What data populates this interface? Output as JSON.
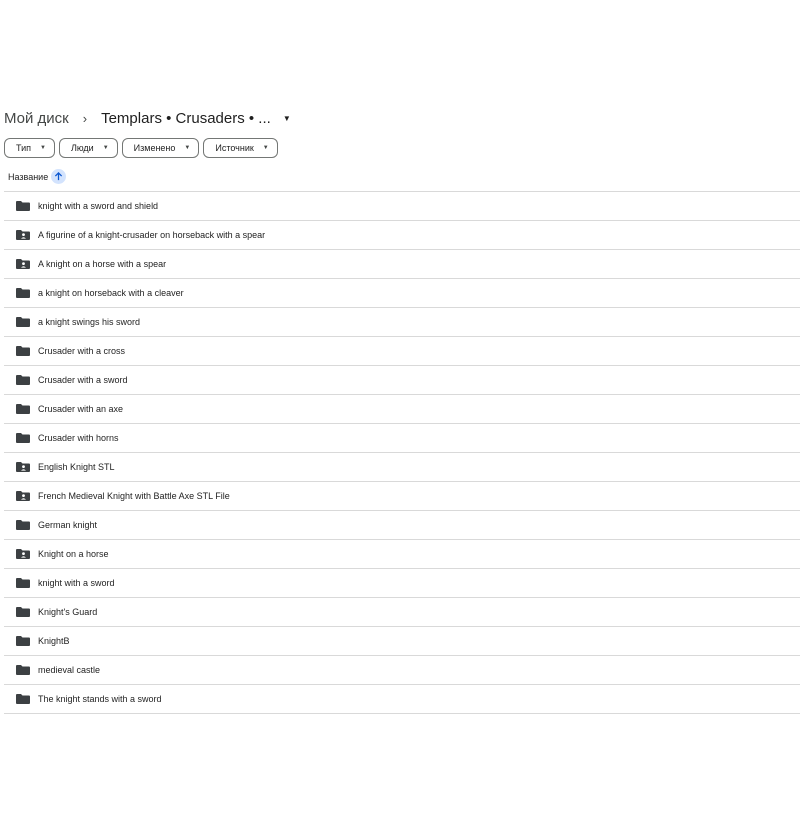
{
  "breadcrumb": {
    "root": "Мой диск",
    "separator": "›",
    "current": "Templars • Crusaders • ...",
    "caret_icon": "caret-down-icon"
  },
  "filters": [
    {
      "label": "Тип",
      "icon": "caret-down-icon"
    },
    {
      "label": "Люди",
      "icon": "caret-down-icon"
    },
    {
      "label": "Изменено",
      "icon": "caret-down-icon"
    },
    {
      "label": "Источник",
      "icon": "caret-down-icon"
    }
  ],
  "column_header": {
    "name_label": "Название",
    "sort_icon": "arrow-up-icon"
  },
  "files": [
    {
      "name": " knight with a sword and shield",
      "icon": "folder-icon"
    },
    {
      "name": "A figurine of a knight-crusader on horseback with a spear",
      "icon": "shared-folder-icon"
    },
    {
      "name": "A knight on a horse with a spear",
      "icon": "shared-folder-icon"
    },
    {
      "name": "a knight on horseback with a cleaver",
      "icon": "folder-icon"
    },
    {
      "name": "a knight swings his sword",
      "icon": "folder-icon"
    },
    {
      "name": "Crusader with a cross",
      "icon": "folder-icon"
    },
    {
      "name": "Crusader with a sword",
      "icon": "folder-icon"
    },
    {
      "name": "Crusader with an axe",
      "icon": "folder-icon"
    },
    {
      "name": "Crusader with horns",
      "icon": "folder-icon"
    },
    {
      "name": "English Knight STL",
      "icon": "shared-folder-icon"
    },
    {
      "name": "French Medieval Knight with Battle Axe STL File",
      "icon": "shared-folder-icon"
    },
    {
      "name": "German knight",
      "icon": "folder-icon"
    },
    {
      "name": "Knight on a horse",
      "icon": "shared-folder-icon"
    },
    {
      "name": "knight with a sword",
      "icon": "folder-icon"
    },
    {
      "name": "Knight's Guard",
      "icon": "folder-icon"
    },
    {
      "name": "KnightB",
      "icon": "folder-icon"
    },
    {
      "name": "medieval castle",
      "icon": "folder-icon"
    },
    {
      "name": "The knight stands with a sword",
      "icon": "folder-icon"
    }
  ],
  "colors": {
    "folder": "#3c4043",
    "sort_highlight": "#d3e3fd",
    "sort_arrow": "#0b57d0",
    "divider": "#d9d9d9"
  }
}
